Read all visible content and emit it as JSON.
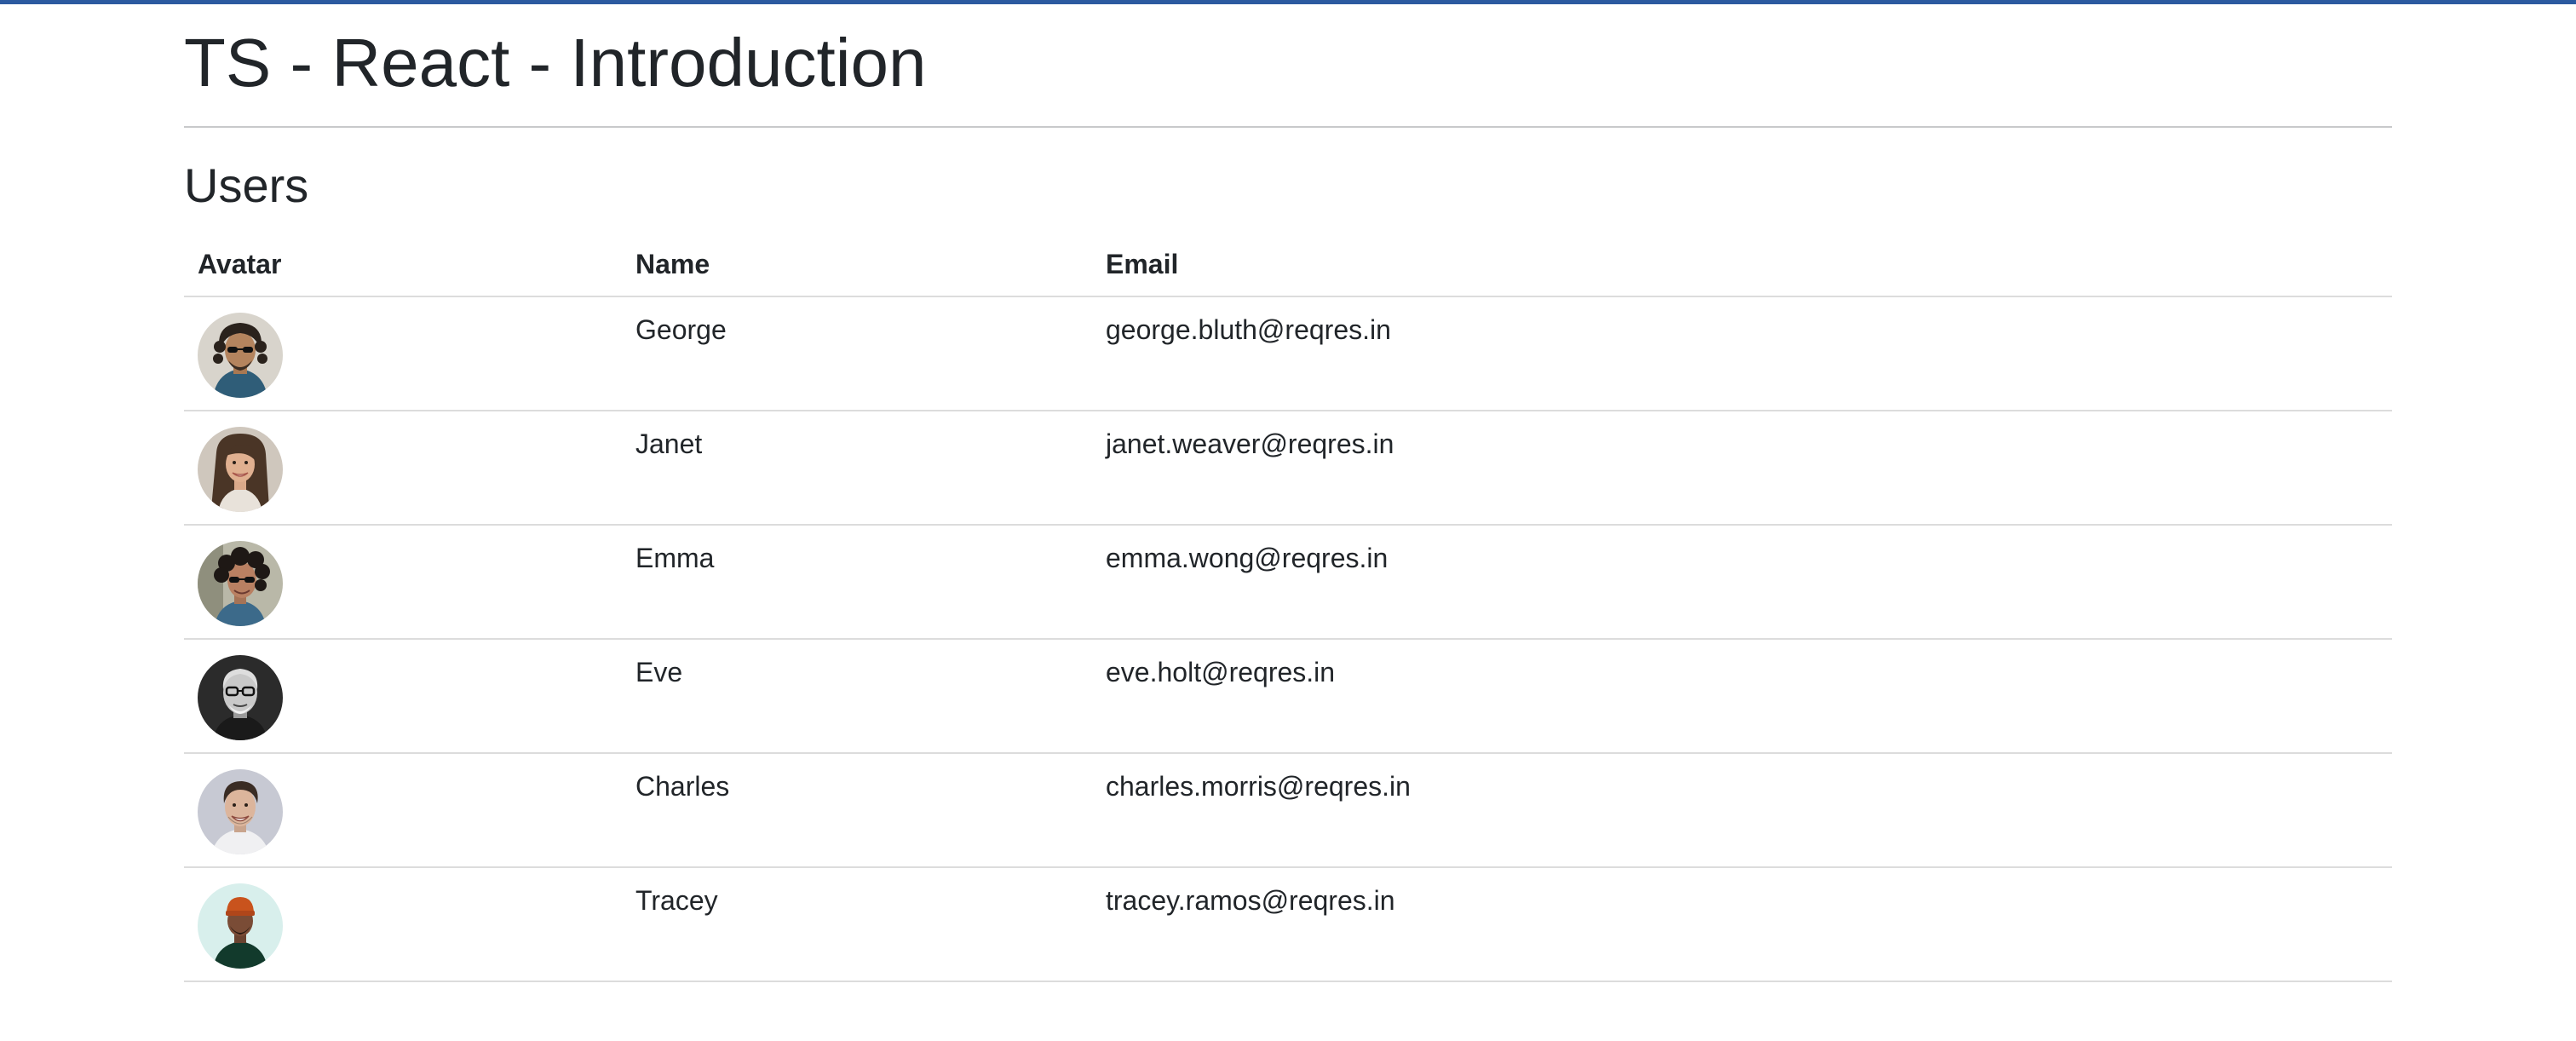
{
  "page": {
    "title": "TS - React - Introduction",
    "accent_color": "#2c5aa0"
  },
  "users_section": {
    "heading": "Users",
    "columns": {
      "avatar": "Avatar",
      "name": "Name",
      "email": "Email"
    },
    "rows": [
      {
        "name": "George",
        "email": "george.bluth@reqres.in",
        "avatar_icon": "person-avatar-sunglasses-curly-hair"
      },
      {
        "name": "Janet",
        "email": "janet.weaver@reqres.in",
        "avatar_icon": "person-avatar-smiling-long-hair"
      },
      {
        "name": "Emma",
        "email": "emma.wong@reqres.in",
        "avatar_icon": "person-avatar-sunglasses-curly-hair"
      },
      {
        "name": "Eve",
        "email": "eve.holt@reqres.in",
        "avatar_icon": "person-avatar-glasses-bald-grayscale"
      },
      {
        "name": "Charles",
        "email": "charles.morris@reqres.in",
        "avatar_icon": "person-avatar-smiling-short-hair"
      },
      {
        "name": "Tracey",
        "email": "tracey.ramos@reqres.in",
        "avatar_icon": "person-avatar-orange-beanie"
      }
    ]
  }
}
